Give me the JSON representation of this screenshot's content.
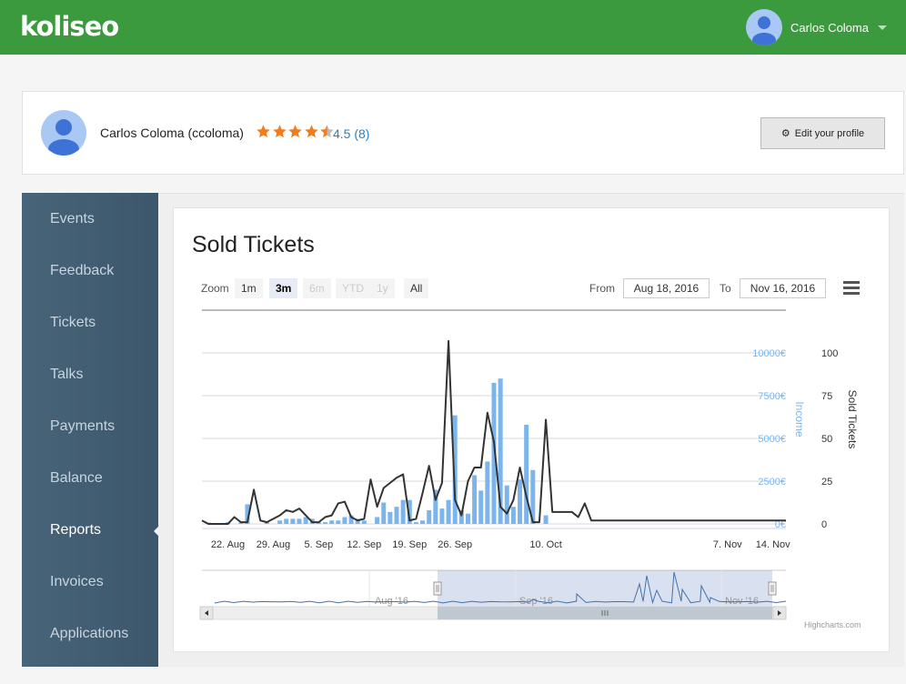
{
  "header": {
    "logo": "koliseo",
    "user_name": "Carlos Coloma"
  },
  "profile": {
    "name": "Carlos Coloma (ccoloma)",
    "rating_text": "4.5 (8)",
    "rating_value": 4.5,
    "rating_max": 5,
    "edit_label": "Edit your profile",
    "star_color": "#f07d1d"
  },
  "sidebar": {
    "active": "Reports",
    "items": [
      {
        "label": "Events"
      },
      {
        "label": "Feedback"
      },
      {
        "label": "Tickets"
      },
      {
        "label": "Talks"
      },
      {
        "label": "Payments"
      },
      {
        "label": "Balance"
      },
      {
        "label": "Reports"
      },
      {
        "label": "Invoices"
      },
      {
        "label": "Applications"
      }
    ]
  },
  "panel": {
    "title": "Sold Tickets"
  },
  "chart_toolbar": {
    "zoom_label": "Zoom",
    "zoom_buttons": [
      {
        "label": "1m",
        "state": "normal"
      },
      {
        "label": "3m",
        "state": "active"
      },
      {
        "label": "6m",
        "state": "disabled"
      },
      {
        "label": "YTD",
        "state": "disabled"
      },
      {
        "label": "1y",
        "state": "disabled"
      },
      {
        "label": "All",
        "state": "normal"
      }
    ],
    "from_label": "From",
    "from_value": "Aug 18, 2016",
    "to_label": "To",
    "to_value": "Nov 16, 2016"
  },
  "chart_data": {
    "type": "bar",
    "x_start": "2016-08-18",
    "x_end": "2016-11-16",
    "x_ticks": [
      "22. Aug",
      "29. Aug",
      "5. Sep",
      "12. Sep",
      "19. Sep",
      "26. Sep",
      "10. Oct",
      "7. Nov",
      "14. Nov"
    ],
    "y_axes": [
      {
        "title": "Income",
        "ticks": [
          "0€",
          "2500€",
          "5000€",
          "7500€",
          "10000€"
        ],
        "range": [
          0,
          10000
        ],
        "color": "#7cb5ec"
      },
      {
        "title": "Sold Tickets",
        "ticks": [
          "0",
          "25",
          "50",
          "75",
          "100"
        ],
        "range": [
          0,
          100
        ],
        "color": "#333333"
      }
    ],
    "series": [
      {
        "name": "Income",
        "type": "bar",
        "color": "#7cb5ec",
        "points": [
          [
            "2016-08-19",
            80
          ],
          [
            "2016-08-22",
            100
          ],
          [
            "2016-08-24",
            80
          ],
          [
            "2016-08-25",
            1150
          ],
          [
            "2016-08-28",
            100
          ],
          [
            "2016-08-30",
            200
          ],
          [
            "2016-08-31",
            300
          ],
          [
            "2016-09-01",
            300
          ],
          [
            "2016-09-02",
            300
          ],
          [
            "2016-09-03",
            400
          ],
          [
            "2016-09-04",
            300
          ],
          [
            "2016-09-05",
            100
          ],
          [
            "2016-09-06",
            100
          ],
          [
            "2016-09-07",
            200
          ],
          [
            "2016-09-08",
            200
          ],
          [
            "2016-09-09",
            400
          ],
          [
            "2016-09-10",
            500
          ],
          [
            "2016-09-11",
            300
          ],
          [
            "2016-09-12",
            200
          ],
          [
            "2016-09-14",
            400
          ],
          [
            "2016-09-15",
            1250
          ],
          [
            "2016-09-16",
            700
          ],
          [
            "2016-09-17",
            1000
          ],
          [
            "2016-09-18",
            1400
          ],
          [
            "2016-09-19",
            1400
          ],
          [
            "2016-09-20",
            100
          ],
          [
            "2016-09-21",
            200
          ],
          [
            "2016-09-22",
            800
          ],
          [
            "2016-09-23",
            2000
          ],
          [
            "2016-09-24",
            900
          ],
          [
            "2016-09-25",
            1400
          ],
          [
            "2016-09-26",
            6350
          ],
          [
            "2016-09-27",
            800
          ],
          [
            "2016-09-28",
            600
          ],
          [
            "2016-09-29",
            2850
          ],
          [
            "2016-09-30",
            1950
          ],
          [
            "2016-10-01",
            3650
          ],
          [
            "2016-10-02",
            8250
          ],
          [
            "2016-10-03",
            8500
          ],
          [
            "2016-10-04",
            2250
          ],
          [
            "2016-10-05",
            1000
          ],
          [
            "2016-10-06",
            2600
          ],
          [
            "2016-10-07",
            5800
          ],
          [
            "2016-10-08",
            3150
          ],
          [
            "2016-10-10",
            500
          ]
        ]
      },
      {
        "name": "Sold Tickets",
        "type": "line",
        "color": "#333333",
        "points": [
          [
            "2016-08-18",
            2
          ],
          [
            "2016-08-19",
            0
          ],
          [
            "2016-08-22",
            0
          ],
          [
            "2016-08-23",
            4
          ],
          [
            "2016-08-24",
            1
          ],
          [
            "2016-08-25",
            1
          ],
          [
            "2016-08-26",
            20
          ],
          [
            "2016-08-27",
            2
          ],
          [
            "2016-08-28",
            1
          ],
          [
            "2016-08-29",
            3
          ],
          [
            "2016-08-30",
            5
          ],
          [
            "2016-08-31",
            8
          ],
          [
            "2016-09-01",
            7
          ],
          [
            "2016-09-02",
            9
          ],
          [
            "2016-09-03",
            5
          ],
          [
            "2016-09-04",
            1
          ],
          [
            "2016-09-05",
            1
          ],
          [
            "2016-09-06",
            4
          ],
          [
            "2016-09-07",
            5
          ],
          [
            "2016-09-08",
            12
          ],
          [
            "2016-09-09",
            13
          ],
          [
            "2016-09-10",
            4
          ],
          [
            "2016-09-11",
            2
          ],
          [
            "2016-09-12",
            3
          ],
          [
            "2016-09-13",
            26
          ],
          [
            "2016-09-14",
            10
          ],
          [
            "2016-09-15",
            21
          ],
          [
            "2016-09-16",
            24
          ],
          [
            "2016-09-17",
            27
          ],
          [
            "2016-09-18",
            29
          ],
          [
            "2016-09-19",
            2
          ],
          [
            "2016-09-20",
            3
          ],
          [
            "2016-09-21",
            18
          ],
          [
            "2016-09-22",
            34
          ],
          [
            "2016-09-23",
            14
          ],
          [
            "2016-09-24",
            24
          ],
          [
            "2016-09-25",
            107
          ],
          [
            "2016-09-26",
            14
          ],
          [
            "2016-09-27",
            5
          ],
          [
            "2016-09-28",
            25
          ],
          [
            "2016-09-29",
            33
          ],
          [
            "2016-09-30",
            33
          ],
          [
            "2016-10-01",
            65
          ],
          [
            "2016-10-02",
            48
          ],
          [
            "2016-10-03",
            10
          ],
          [
            "2016-10-04",
            6
          ],
          [
            "2016-10-05",
            14
          ],
          [
            "2016-10-06",
            33
          ],
          [
            "2016-10-07",
            16
          ],
          [
            "2016-10-08",
            1
          ],
          [
            "2016-10-09",
            1
          ],
          [
            "2016-10-10",
            61
          ],
          [
            "2016-10-11",
            7
          ],
          [
            "2016-10-12",
            7
          ],
          [
            "2016-10-13",
            7
          ],
          [
            "2016-10-14",
            7
          ],
          [
            "2016-10-15",
            4
          ],
          [
            "2016-10-16",
            12
          ],
          [
            "2016-10-17",
            2
          ],
          [
            "2016-10-18",
            2
          ],
          [
            "2016-10-19",
            2
          ]
        ]
      }
    ],
    "grid": true
  },
  "navigator": {
    "labels": [
      "Aug '16",
      "Sep '16",
      "Nov '16"
    ],
    "selected_from": "2016-08-18",
    "selected_to": "2016-11-16"
  },
  "credits": "Highcharts.com"
}
